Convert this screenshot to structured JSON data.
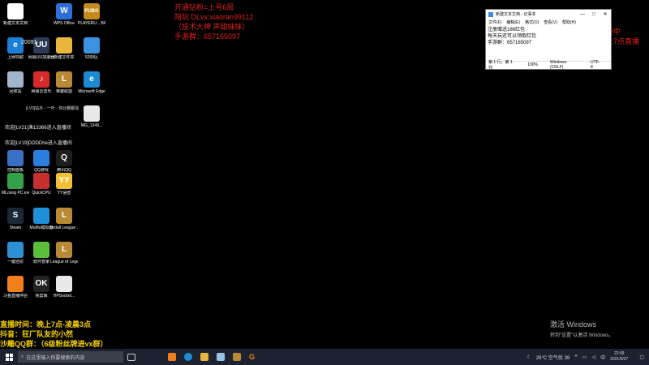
{
  "desktop_icons": [
    {
      "label": "新建文本文档",
      "glyph": "",
      "color": "#ffffff"
    },
    {
      "label": "WPS Office",
      "glyph": "W",
      "color": "#2d6fd8"
    },
    {
      "label": "PLAYERU... BATTLEGR...",
      "glyph": "PUBG",
      "color": "#c58a1c"
    },
    {
      "label": "上网导航",
      "glyph": "e",
      "color": "#1b7fd6"
    },
    {
      "label": "网易UU加速器",
      "glyph": "UU",
      "color": "#2c3a55"
    },
    {
      "label": "新建文件夹",
      "glyph": "",
      "color": "#e9b640"
    },
    {
      "label": "5268区",
      "glyph": "",
      "color": "#3a92e0"
    },
    {
      "label": "回收站",
      "glyph": "",
      "color": "#9fb6cc"
    },
    {
      "label": "网易云音乐",
      "glyph": "♪",
      "color": "#d62c2c"
    },
    {
      "label": "英雄联盟",
      "glyph": "L",
      "color": "#b88a35"
    },
    {
      "label": "Microsoft Edge",
      "glyph": "e",
      "color": "#1d8bd0"
    },
    {
      "label": "MG_1349...",
      "glyph": "",
      "color": "#e8e8e8"
    },
    {
      "label": "控制面板",
      "glyph": "",
      "color": "#3a6fc6"
    },
    {
      "label": "QQ游戏",
      "glyph": "",
      "color": "#2c7de0"
    },
    {
      "label": "腾讯QQ",
      "glyph": "Q",
      "color": "#1e1e1e"
    },
    {
      "label": "MLoong PC.exe",
      "glyph": "",
      "color": "#35a04a"
    },
    {
      "label": "QuickCPU",
      "glyph": "",
      "color": "#c83030"
    },
    {
      "label": "YY语音",
      "glyph": "YY",
      "color": "#f2c034"
    },
    {
      "label": "Steam",
      "glyph": "S",
      "color": "#1b2838"
    },
    {
      "label": "MuMu模拟器",
      "glyph": "",
      "color": "#1f8fd8"
    },
    {
      "label": "Install League ...",
      "glyph": "L",
      "color": "#b88a35"
    },
    {
      "label": "一键还原",
      "glyph": "",
      "color": "#2d8fd6"
    },
    {
      "label": "软件管家",
      "glyph": "",
      "color": "#5abf3a"
    },
    {
      "label": "League of Legends",
      "glyph": "L",
      "color": "#b88a35"
    },
    {
      "label": "斗鱼直播伴侣",
      "glyph": "",
      "color": "#f07f1c"
    },
    {
      "label": "快剪辑",
      "glyph": "OK",
      "color": "#222222"
    },
    {
      "label": "HPSocket...",
      "glyph": "",
      "color": "#e8e8e8"
    }
  ],
  "desktop_partial_labels": [
    "[LV0]站外 - 一叶 - 你比霸都强",
    "欢迎[LV21]渔13366进入直播间",
    "欢迎[LV19]DDDDhe进入直播间",
    "20091"
  ],
  "promo_overlay": {
    "line1": "开通钻粉=上号6局",
    "line2": "陪玩 DLvx:xiaoran99112",
    "line3": "（技术大神 声甜妹妹）",
    "line4": "手游群：657165097"
  },
  "right_overlay": {
    "line1": "吃饭中",
    "line2": "晚上7点直播"
  },
  "stream_banner": {
    "line1": "直播时间：晚上7点-凌晨3点",
    "line2": "抖音：狂厂队友的小然",
    "line3": "沙雕QQ群：（6级粉丝牌进vx群）"
  },
  "notepad": {
    "title": "新建文本文档 - 记事本",
    "menu": [
      "文件(F)",
      "编辑(E)",
      "格式(O)",
      "查看(V)",
      "帮助(H)"
    ],
    "lines": [
      "注册赠送188红包",
      "每天玩还可以领取红包",
      "手游群：657165097"
    ],
    "status": {
      "position": "第 1 行，第 1 列",
      "zoom": "100%",
      "eol": "Windows (CRLF)",
      "encoding": "UTF-8"
    }
  },
  "activation": {
    "title": "激活 Windows",
    "subtitle": "转到\"设置\"以激活 Windows。"
  },
  "taskbar": {
    "search_placeholder": "在这里输入你要搜索的内容",
    "weather": "26°C 空气优 39",
    "time": "22:09",
    "date": "2021/9/27"
  }
}
